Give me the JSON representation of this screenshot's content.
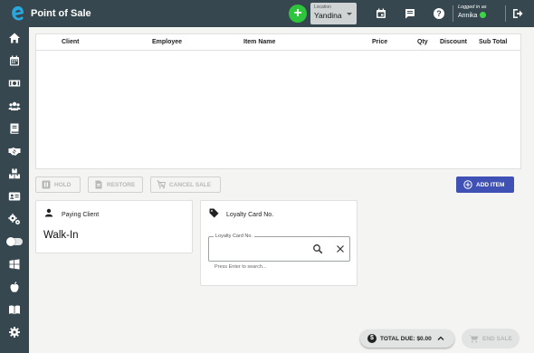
{
  "header": {
    "title": "Point of Sale",
    "location_label": "Location",
    "location_value": "Yandina",
    "logged_in_label": "Logged in as",
    "user_name": "Annika",
    "status_color": "#3ed44a",
    "accent": "#2ec43b",
    "bar_color": "#37474f"
  },
  "sidebar": {
    "items": [
      {
        "icon": "home-icon"
      },
      {
        "icon": "calendar-icon"
      },
      {
        "icon": "cash-icon"
      },
      {
        "icon": "people-icon"
      },
      {
        "icon": "book-icon"
      },
      {
        "icon": "handshake-icon"
      },
      {
        "icon": "boxes-icon"
      },
      {
        "icon": "id-card-icon"
      },
      {
        "icon": "settings-icon"
      },
      {
        "icon": "toggle-icon"
      },
      {
        "icon": "windows-icon"
      },
      {
        "icon": "apple-icon"
      },
      {
        "icon": "map-icon"
      },
      {
        "icon": "gear-icon"
      }
    ]
  },
  "table": {
    "columns": [
      "Client",
      "Employee",
      "Item Name",
      "Price",
      "Qty",
      "Discount",
      "Sub Total"
    ],
    "rows": []
  },
  "actions": {
    "hold": "HOLD",
    "restore": "RESTORE",
    "cancel_sale": "CANCEL SALE",
    "add_item": "ADD ITEM",
    "add_item_color": "#3f51b5"
  },
  "paying_client": {
    "title": "Paying Client",
    "value": "Walk-In"
  },
  "loyalty": {
    "title": "Loyalty Card No.",
    "field_label": "Loyalty Card No.",
    "value": "",
    "hint": "Press Enter to search..."
  },
  "footer": {
    "total_due": "TOTAL DUE: $0.00",
    "end_sale": "END SALE"
  }
}
